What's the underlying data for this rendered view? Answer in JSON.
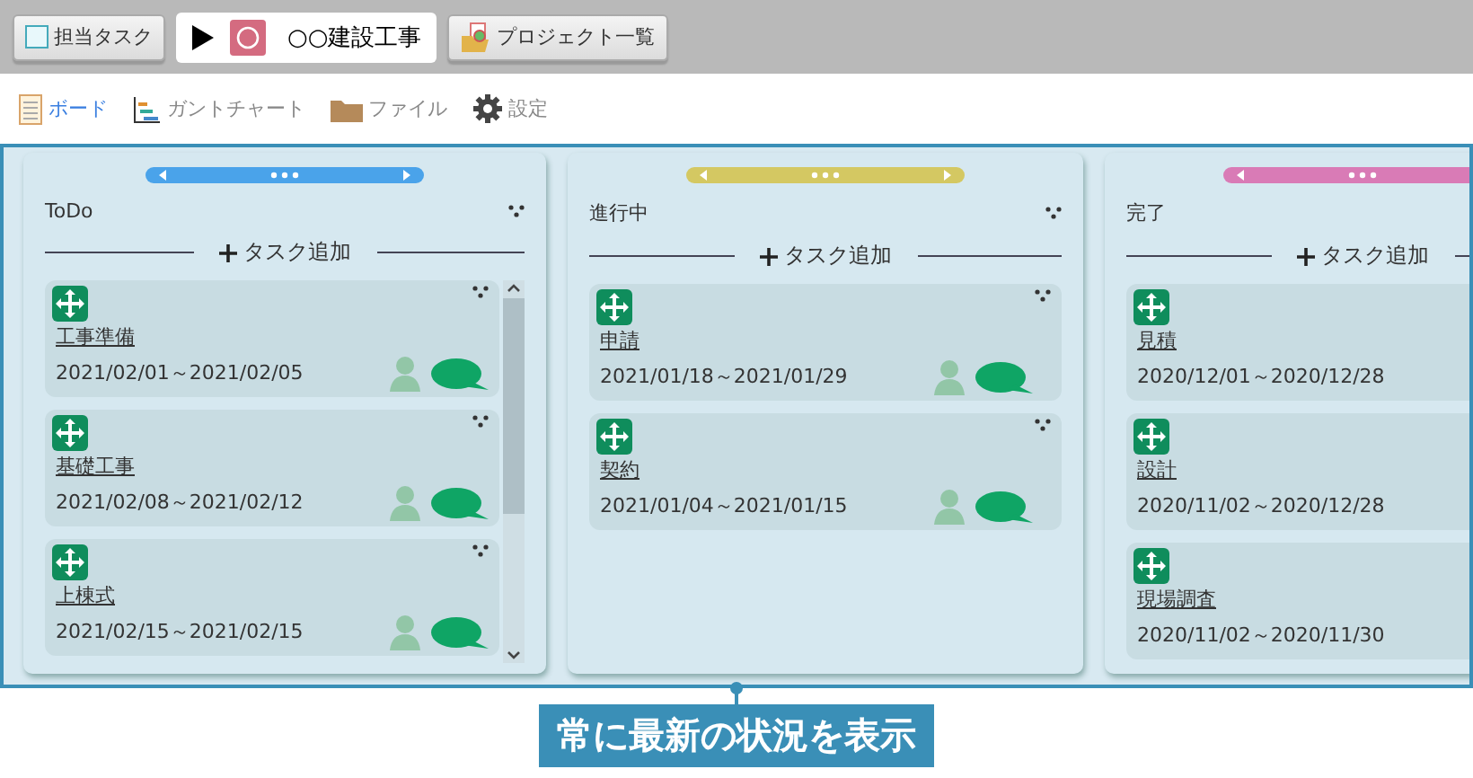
{
  "toolbar": {
    "my_tasks": "担当タスク",
    "project": {
      "name": "○○建設工事"
    },
    "project_list": "プロジェクト一覧"
  },
  "nav_tabs": [
    {
      "label": "ボード",
      "selected": true
    },
    {
      "label": "ガントチャート",
      "selected": false
    },
    {
      "label": "ファイル",
      "selected": false
    },
    {
      "label": "設定",
      "selected": false
    }
  ],
  "columns": [
    {
      "title": "ToDo",
      "color": "#4aa3ea",
      "add_label": "タスク追加",
      "scrollbar": true,
      "cards": [
        {
          "title": "工事準備",
          "dates": "2021/02/01～2021/02/05"
        },
        {
          "title": "基礎工事",
          "dates": "2021/02/08～2021/02/12"
        },
        {
          "title": "上棟式",
          "dates": "2021/02/15～2021/02/15"
        }
      ]
    },
    {
      "title": "進行中",
      "color": "#d4c862",
      "add_label": "タスク追加",
      "scrollbar": false,
      "cards": [
        {
          "title": "申請",
          "dates": "2021/01/18～2021/01/29"
        },
        {
          "title": "契約",
          "dates": "2021/01/04～2021/01/15"
        }
      ]
    },
    {
      "title": "完了",
      "color": "#d97bb6",
      "add_label": "タスク追加",
      "cards": [
        {
          "title": "見積",
          "dates": "2020/12/01～2020/12/28"
        },
        {
          "title": "設計",
          "dates": "2020/11/02～2020/12/28"
        },
        {
          "title": "現場調査",
          "dates": "2020/11/02～2020/11/30"
        }
      ]
    }
  ],
  "callout": "常に最新の状況を表示"
}
